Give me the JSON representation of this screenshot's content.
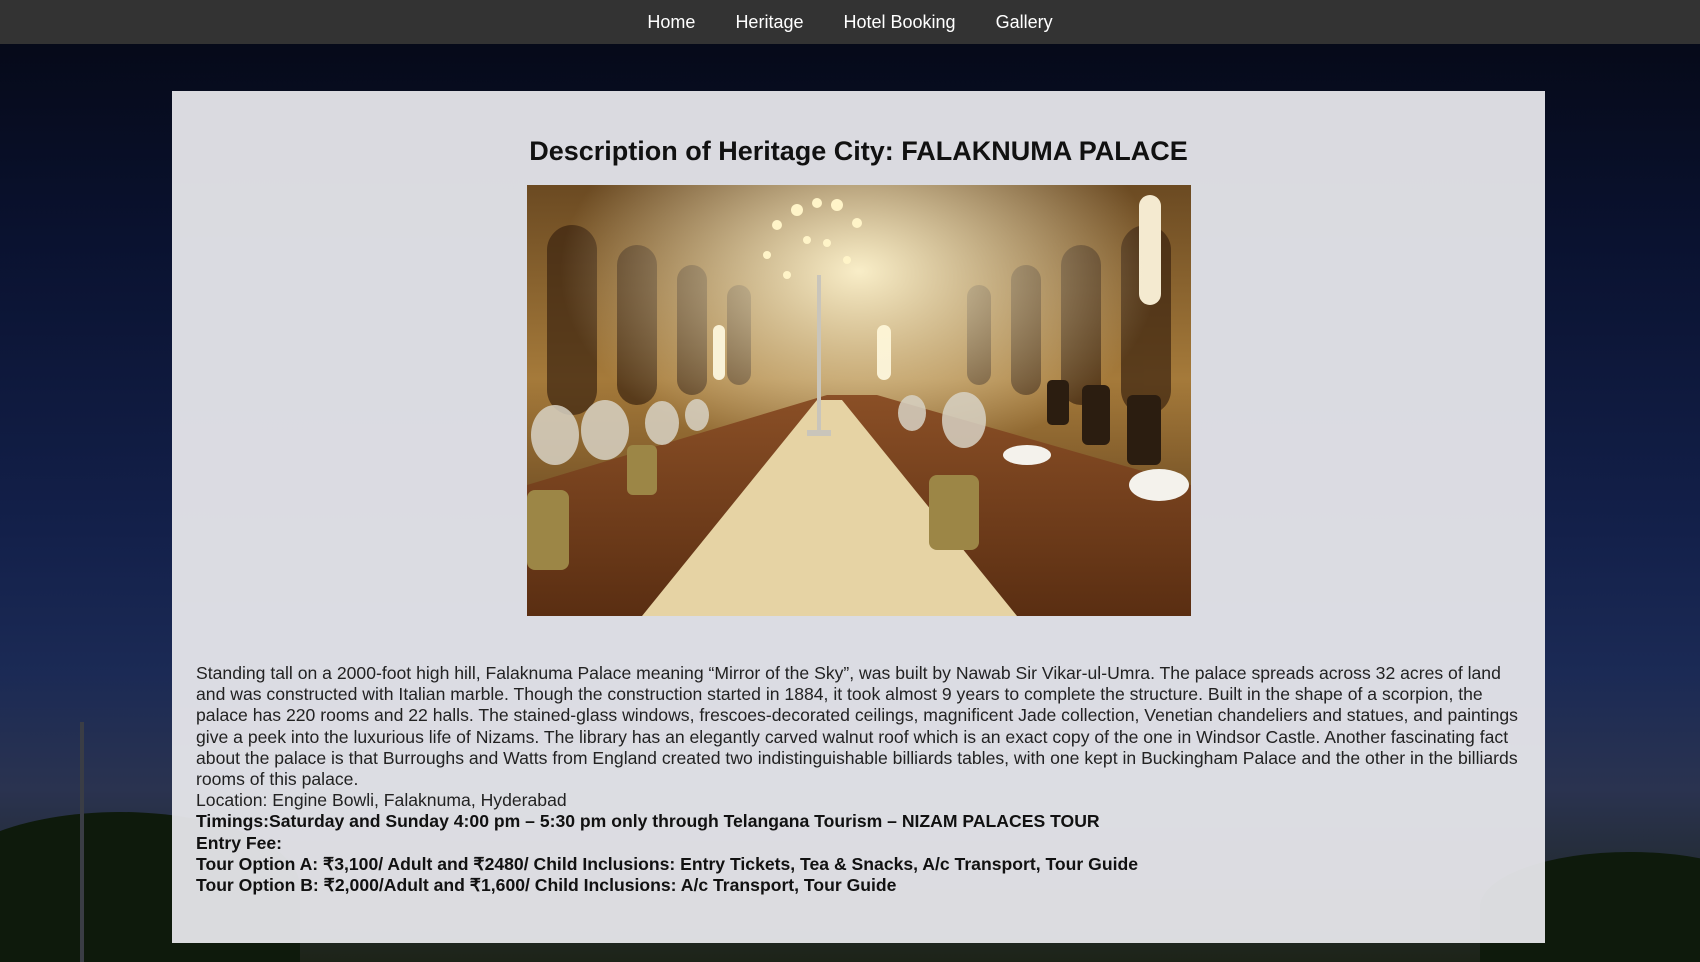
{
  "nav": {
    "items": [
      {
        "label": "Home"
      },
      {
        "label": "Heritage"
      },
      {
        "label": "Hotel Booking"
      },
      {
        "label": "Gallery"
      }
    ]
  },
  "page": {
    "title": "Description of Heritage City: FALAKNUMA PALACE",
    "image_alt": "Falaknuma Palace dining hall",
    "description": "Standing tall on a 2000-foot high hill, Falaknuma Palace meaning “Mirror of the Sky”, was built by Nawab Sir Vikar-ul-Umra. The palace spreads across 32 acres of land and was constructed with Italian marble. Though the construction started in 1884, it took almost 9 years to complete the structure. Built in the shape of a scorpion, the palace has 220 rooms and 22 halls. The stained-glass windows, frescoes-decorated ceilings, magnificent Jade collection, Venetian chandeliers and statues, and paintings give a peek into the luxurious life of Nizams. The library has an elegantly carved walnut roof which is an exact copy of the one in Windsor Castle. Another fascinating fact about the palace is that Burroughs and Watts from England created two indistinguishable billiards tables, with one kept in Buckingham Palace and the other in the billiards rooms of this palace.",
    "location": "Location: Engine Bowli, Falaknuma, Hyderabad",
    "timings": "Timings:Saturday and Sunday 4:00 pm – 5:30 pm only through Telangana Tourism – NIZAM PALACES TOUR",
    "entry_fee": "Entry Fee:",
    "tour_a": "Tour Option A: ₹3,100/ Adult and ₹2480/ Child Inclusions: Entry Tickets, Tea & Snacks, A/c Transport, Tour Guide",
    "tour_b": "Tour Option B: ₹2,000/Adult and ₹1,600/ Child Inclusions: A/c Transport, Tour Guide"
  },
  "colors": {
    "nav_bg": "#333333",
    "panel_bg": "#e8e8ec",
    "text": "#222222"
  }
}
